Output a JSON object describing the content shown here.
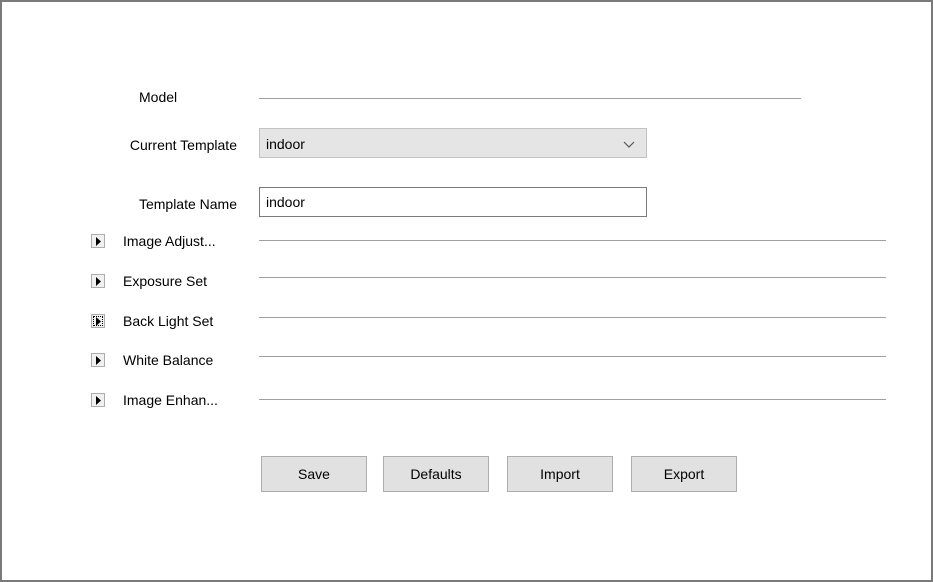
{
  "form": {
    "model_label": "Model",
    "model_value": "",
    "current_template_label": "Current Template",
    "current_template_value": "indoor",
    "template_name_label": "Template Name",
    "template_name_value": "indoor"
  },
  "sections": [
    {
      "label": "Image Adjust...",
      "expanded": false
    },
    {
      "label": "Exposure Set",
      "expanded": false
    },
    {
      "label": "Back Light Set",
      "expanded": false,
      "focused": true
    },
    {
      "label": "White Balance",
      "expanded": false
    },
    {
      "label": "Image Enhan...",
      "expanded": false
    }
  ],
  "buttons": {
    "save": "Save",
    "defaults": "Defaults",
    "import": "Import",
    "export": "Export"
  },
  "icons": {
    "dropdown": "chevron-down-icon",
    "expand": "triangle-right-icon"
  },
  "colors": {
    "frame_border": "#7a7a7a",
    "button_bg": "#e1e1e1",
    "select_bg": "#e5e5e5"
  }
}
